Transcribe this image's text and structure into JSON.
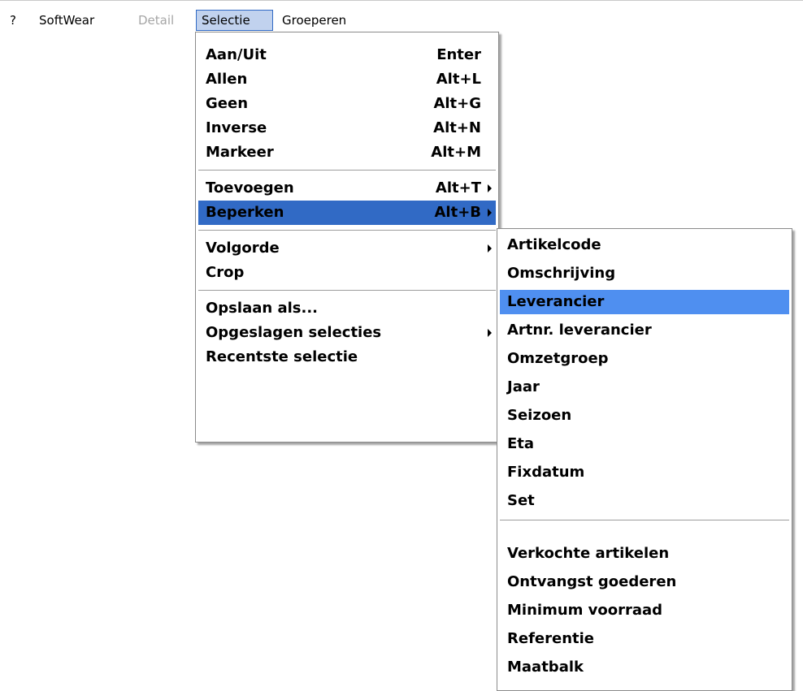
{
  "menubar": {
    "items": [
      {
        "label": "?",
        "state": "normal"
      },
      {
        "label": "SoftWear",
        "state": "normal"
      },
      {
        "label": "Detail",
        "state": "disabled"
      },
      {
        "label": "Selectie",
        "state": "active"
      },
      {
        "label": "Groeperen",
        "state": "normal"
      }
    ]
  },
  "selectie_menu": {
    "group1": [
      {
        "label": "Aan/Uit",
        "shortcut": "Enter"
      },
      {
        "label": "Allen",
        "shortcut": "Alt+L"
      },
      {
        "label": "Geen",
        "shortcut": "Alt+G"
      },
      {
        "label": "Inverse",
        "shortcut": "Alt+N"
      },
      {
        "label": "Markeer",
        "shortcut": "Alt+M"
      }
    ],
    "group2": [
      {
        "label": "Toevoegen",
        "shortcut": "Alt+T",
        "submenu": true
      },
      {
        "label": "Beperken",
        "shortcut": "Alt+B",
        "submenu": true,
        "highlighted": true
      }
    ],
    "group3": [
      {
        "label": "Volgorde",
        "shortcut": "",
        "submenu": true
      },
      {
        "label": "Crop",
        "shortcut": ""
      }
    ],
    "group4": [
      {
        "label": "Opslaan als...",
        "shortcut": ""
      },
      {
        "label": "Opgeslagen selecties",
        "shortcut": "",
        "submenu": true
      },
      {
        "label": "Recentste selectie",
        "shortcut": ""
      }
    ]
  },
  "beperken_submenu": {
    "group1": [
      {
        "label": "Artikelcode"
      },
      {
        "label": "Omschrijving"
      },
      {
        "label": "Leverancier",
        "highlighted": true
      },
      {
        "label": "Artnr. leverancier"
      },
      {
        "label": "Omzetgroep"
      },
      {
        "label": "Jaar"
      },
      {
        "label": "Seizoen"
      },
      {
        "label": "Eta"
      },
      {
        "label": "Fixdatum"
      },
      {
        "label": "Set"
      }
    ],
    "group2": [
      {
        "label": "Verkochte artikelen"
      },
      {
        "label": "Ontvangst goederen"
      },
      {
        "label": "Minimum voorraad"
      },
      {
        "label": "Referentie"
      },
      {
        "label": "Maatbalk"
      }
    ]
  },
  "colors": {
    "highlight": "#316ac5",
    "submenu_highlight": "#4f8ff0",
    "active_menubar_bg": "#c1d2ee"
  }
}
